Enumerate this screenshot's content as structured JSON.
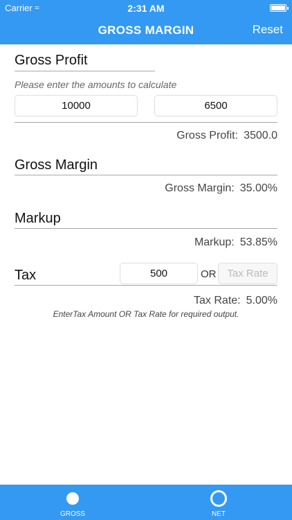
{
  "status_bar": {
    "carrier": "Carrier",
    "time": "2:31 AM"
  },
  "nav": {
    "title": "GROSS MARGIN",
    "reset_label": "Reset"
  },
  "gross_profit": {
    "title": "Gross Profit",
    "hint": "Please enter the amounts to calculate",
    "field_1_value": "10000",
    "field_2_value": "6500",
    "result_label": "Gross Profit:",
    "result_value": "3500.0"
  },
  "gross_margin": {
    "title": "Gross Margin",
    "result_label": "Gross Margin:",
    "result_value": "35.00%"
  },
  "markup": {
    "title": "Markup",
    "result_label": "Markup:",
    "result_value": "53.85%"
  },
  "tax": {
    "title": "Tax",
    "amount_value": "500",
    "or_label": "OR",
    "rate_placeholder": "Tax Rate",
    "result_label": "Tax Rate:",
    "result_value": "5.00%",
    "note": "EnterTax Amount OR Tax Rate for required output."
  },
  "tabs": [
    {
      "label": "GROSS",
      "icon": "filled-circle-icon"
    },
    {
      "label": "NET",
      "icon": "ring-icon"
    }
  ],
  "colors": {
    "accent": "#3399f3"
  }
}
